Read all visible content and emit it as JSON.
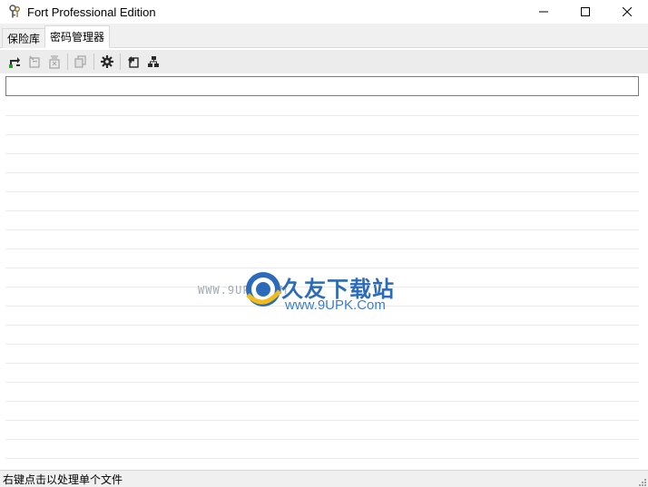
{
  "window": {
    "title": "Fort Professional Edition",
    "minimize_symbol": "—",
    "maximize_symbol": "☐",
    "close_symbol": "✕"
  },
  "tabs": [
    {
      "label": "保险库",
      "selected": false
    },
    {
      "label": "密码管理器",
      "selected": true
    }
  ],
  "toolbar": {
    "icons": [
      "refresh-add-icon",
      "edit-icon",
      "delete-icon",
      "copy-icon",
      "settings-icon",
      "import-icon",
      "network-icon"
    ]
  },
  "search": {
    "value": ""
  },
  "status": {
    "text": "右键点击以处理单个文件"
  },
  "watermark": {
    "url_left": "WWW.9UPK.COM",
    "brand": "久友下载站",
    "site": "www.9UPK.Com"
  },
  "colors": {
    "accent": "#1a5fb4",
    "toolbar_icon": "#2a2a2a"
  }
}
